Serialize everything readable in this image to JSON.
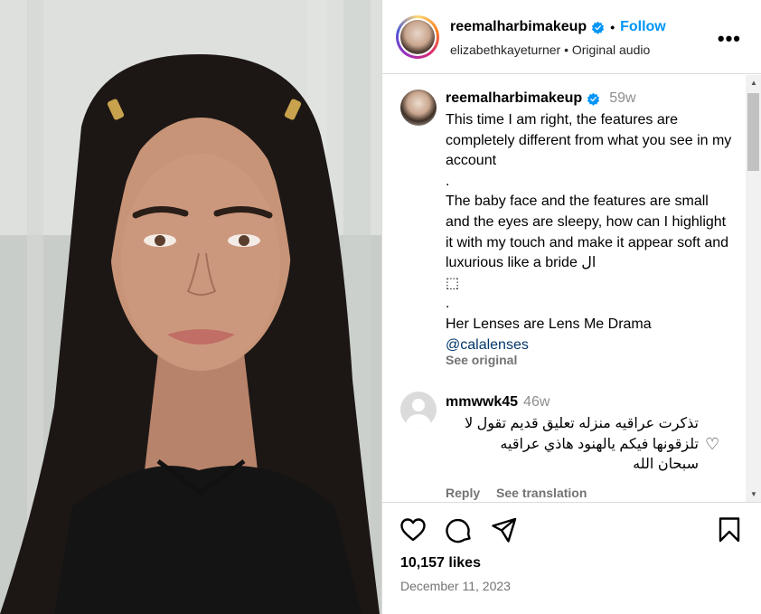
{
  "post": {
    "author": "reemalharbimakeup",
    "follow_label": "Follow",
    "separator": "•",
    "audio_user": "elizabethkayeturner",
    "audio_sep": "•",
    "audio_label": "Original audio",
    "more_label": "•••"
  },
  "caption": {
    "author": "reemalharbimakeup",
    "time": "59w",
    "lines": [
      "This time I am right, the features are completely different from what you see in my account",
      ".",
      "The baby face and the features are small and the eyes are sleepy, how can I highlight it with my touch and make it appear soft and luxurious like a bride ال",
      "⬚",
      ".",
      "Her Lenses are Lens Me Drama"
    ],
    "mention": "@calalenses",
    "see_original": "See original"
  },
  "comment": {
    "author": "mmwwk45",
    "time": "46w",
    "text_lines": [
      "تذكرت عراقيه منزله تعليق قديم تقول لا",
      "تلزقونها فيكم يالهنود هاذي عراقيه",
      "سبحان الله"
    ],
    "reply_label": "Reply",
    "translate_label": "See translation"
  },
  "stats": {
    "likes": "10,157 likes",
    "date": "December 11, 2023"
  },
  "icons": {
    "like": "heart-icon",
    "comment": "comment-icon",
    "share": "share-icon",
    "save": "bookmark-icon",
    "verified": "verified-badge-icon",
    "more": "more-options-icon"
  },
  "colors": {
    "link_blue": "#0095f6",
    "verified_blue": "#0095f6",
    "muted": "#737373",
    "mention": "#00376b"
  }
}
